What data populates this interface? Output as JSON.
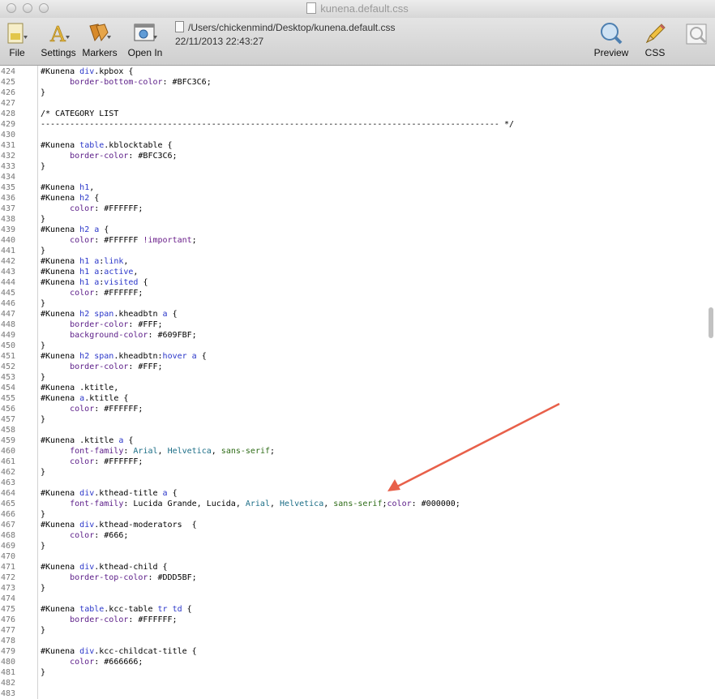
{
  "window": {
    "title": "kunena.default.css"
  },
  "toolbar": {
    "file_label": "File",
    "settings_label": "Settings",
    "markers_label": "Markers",
    "open_in_label": "Open In",
    "preview_label": "Preview",
    "css_label": "CSS",
    "path": "/Users/chickenmind/Desktop/kunena.default.css",
    "timestamp": "22/11/2013 22:43:27"
  },
  "editor": {
    "lines": [
      {
        "num": "424",
        "tokens": [
          [
            "sel",
            "#Kunena "
          ],
          [
            "tag",
            "div"
          ],
          [
            "sel",
            ".kpbox {"
          ]
        ]
      },
      {
        "num": "425",
        "tokens": [
          [
            "p",
            "      "
          ],
          [
            "prop",
            "border-bottom-color"
          ],
          [
            "p",
            ": #BFC3C6;"
          ]
        ]
      },
      {
        "num": "426",
        "tokens": [
          [
            "p",
            "}"
          ]
        ]
      },
      {
        "num": "427",
        "tokens": []
      },
      {
        "num": "428",
        "tokens": [
          [
            "cm",
            "/* CATEGORY LIST"
          ]
        ]
      },
      {
        "num": "429",
        "tokens": [
          [
            "cm",
            "---------------------------------------------------------------------------------------------- */"
          ]
        ]
      },
      {
        "num": "430",
        "tokens": []
      },
      {
        "num": "431",
        "tokens": [
          [
            "sel",
            "#Kunena "
          ],
          [
            "tag",
            "table"
          ],
          [
            "sel",
            ".kblocktable {"
          ]
        ]
      },
      {
        "num": "432",
        "tokens": [
          [
            "p",
            "      "
          ],
          [
            "prop",
            "border-color"
          ],
          [
            "p",
            ": #BFC3C6;"
          ]
        ]
      },
      {
        "num": "433",
        "tokens": [
          [
            "p",
            "}"
          ]
        ]
      },
      {
        "num": "434",
        "tokens": []
      },
      {
        "num": "435",
        "tokens": [
          [
            "sel",
            "#Kunena "
          ],
          [
            "tag",
            "h1"
          ],
          [
            "sel",
            ","
          ]
        ]
      },
      {
        "num": "436",
        "tokens": [
          [
            "sel",
            "#Kunena "
          ],
          [
            "tag",
            "h2"
          ],
          [
            "sel",
            " {"
          ]
        ]
      },
      {
        "num": "437",
        "tokens": [
          [
            "p",
            "      "
          ],
          [
            "prop",
            "color"
          ],
          [
            "p",
            ": #FFFFFF;"
          ]
        ]
      },
      {
        "num": "438",
        "tokens": [
          [
            "p",
            "}"
          ]
        ]
      },
      {
        "num": "439",
        "tokens": [
          [
            "sel",
            "#Kunena "
          ],
          [
            "tag",
            "h2 a"
          ],
          [
            "sel",
            " {"
          ]
        ]
      },
      {
        "num": "440",
        "tokens": [
          [
            "p",
            "      "
          ],
          [
            "prop",
            "color"
          ],
          [
            "p",
            ": #FFFFFF "
          ],
          [
            "imp",
            "!important"
          ],
          [
            "p",
            ";"
          ]
        ]
      },
      {
        "num": "441",
        "tokens": [
          [
            "p",
            "}"
          ]
        ]
      },
      {
        "num": "442",
        "tokens": [
          [
            "sel",
            "#Kunena "
          ],
          [
            "tag",
            "h1 a"
          ],
          [
            "sel",
            ":"
          ],
          [
            "tag",
            "link"
          ],
          [
            "sel",
            ","
          ]
        ]
      },
      {
        "num": "443",
        "tokens": [
          [
            "sel",
            "#Kunena "
          ],
          [
            "tag",
            "h1 a"
          ],
          [
            "sel",
            ":"
          ],
          [
            "tag",
            "active"
          ],
          [
            "sel",
            ","
          ]
        ]
      },
      {
        "num": "444",
        "tokens": [
          [
            "sel",
            "#Kunena "
          ],
          [
            "tag",
            "h1 a"
          ],
          [
            "sel",
            ":"
          ],
          [
            "tag",
            "visited"
          ],
          [
            "sel",
            " {"
          ]
        ]
      },
      {
        "num": "445",
        "tokens": [
          [
            "p",
            "      "
          ],
          [
            "prop",
            "color"
          ],
          [
            "p",
            ": #FFFFFF;"
          ]
        ]
      },
      {
        "num": "446",
        "tokens": [
          [
            "p",
            "}"
          ]
        ]
      },
      {
        "num": "447",
        "tokens": [
          [
            "sel",
            "#Kunena "
          ],
          [
            "tag",
            "h2 span"
          ],
          [
            "sel",
            ".kheadbtn "
          ],
          [
            "tag",
            "a"
          ],
          [
            "sel",
            " {"
          ]
        ]
      },
      {
        "num": "448",
        "tokens": [
          [
            "p",
            "      "
          ],
          [
            "prop",
            "border-color"
          ],
          [
            "p",
            ": #FFF;"
          ]
        ]
      },
      {
        "num": "449",
        "tokens": [
          [
            "p",
            "      "
          ],
          [
            "prop",
            "background-color"
          ],
          [
            "p",
            ": #609FBF;"
          ]
        ]
      },
      {
        "num": "450",
        "tokens": [
          [
            "p",
            "}"
          ]
        ]
      },
      {
        "num": "451",
        "tokens": [
          [
            "sel",
            "#Kunena "
          ],
          [
            "tag",
            "h2 span"
          ],
          [
            "sel",
            ".kheadbtn:"
          ],
          [
            "tag",
            "hover a"
          ],
          [
            "sel",
            " {"
          ]
        ]
      },
      {
        "num": "452",
        "tokens": [
          [
            "p",
            "      "
          ],
          [
            "prop",
            "border-color"
          ],
          [
            "p",
            ": #FFF;"
          ]
        ]
      },
      {
        "num": "453",
        "tokens": [
          [
            "p",
            "}"
          ]
        ]
      },
      {
        "num": "454",
        "tokens": [
          [
            "sel",
            "#Kunena .ktitle,"
          ]
        ]
      },
      {
        "num": "455",
        "tokens": [
          [
            "sel",
            "#Kunena "
          ],
          [
            "tag",
            "a"
          ],
          [
            "sel",
            ".ktitle {"
          ]
        ]
      },
      {
        "num": "456",
        "tokens": [
          [
            "p",
            "      "
          ],
          [
            "prop",
            "color"
          ],
          [
            "p",
            ": #FFFFFF;"
          ]
        ]
      },
      {
        "num": "457",
        "tokens": [
          [
            "p",
            "}"
          ]
        ]
      },
      {
        "num": "458",
        "tokens": []
      },
      {
        "num": "459",
        "tokens": [
          [
            "sel",
            "#Kunena .ktitle "
          ],
          [
            "tag",
            "a"
          ],
          [
            "sel",
            " {"
          ]
        ]
      },
      {
        "num": "460",
        "tokens": [
          [
            "p",
            "      "
          ],
          [
            "prop",
            "font-family"
          ],
          [
            "p",
            ": "
          ],
          [
            "font",
            "Arial"
          ],
          [
            "p",
            ", "
          ],
          [
            "font",
            "Helvetica"
          ],
          [
            "p",
            ", "
          ],
          [
            "gen",
            "sans-serif"
          ],
          [
            "p",
            ";"
          ]
        ]
      },
      {
        "num": "461",
        "tokens": [
          [
            "p",
            "      "
          ],
          [
            "prop",
            "color"
          ],
          [
            "p",
            ": #FFFFFF;"
          ]
        ]
      },
      {
        "num": "462",
        "tokens": [
          [
            "p",
            "}"
          ]
        ]
      },
      {
        "num": "463",
        "tokens": []
      },
      {
        "num": "464",
        "tokens": [
          [
            "sel",
            "#Kunena "
          ],
          [
            "tag",
            "div"
          ],
          [
            "sel",
            ".kthead-title "
          ],
          [
            "tag",
            "a"
          ],
          [
            "sel",
            " {"
          ]
        ]
      },
      {
        "num": "465",
        "tokens": [
          [
            "p",
            "      "
          ],
          [
            "prop",
            "font-family"
          ],
          [
            "p",
            ": Lucida Grande, Lucida, "
          ],
          [
            "font",
            "Arial"
          ],
          [
            "p",
            ", "
          ],
          [
            "font",
            "Helvetica"
          ],
          [
            "p",
            ", "
          ],
          [
            "gen",
            "sans-serif"
          ],
          [
            "p",
            ";"
          ],
          [
            "prop",
            "color"
          ],
          [
            "p",
            ": #000000;"
          ]
        ]
      },
      {
        "num": "466",
        "tokens": [
          [
            "p",
            "}"
          ]
        ]
      },
      {
        "num": "467",
        "tokens": [
          [
            "sel",
            "#Kunena "
          ],
          [
            "tag",
            "div"
          ],
          [
            "sel",
            ".kthead-moderators  {"
          ]
        ]
      },
      {
        "num": "468",
        "tokens": [
          [
            "p",
            "      "
          ],
          [
            "prop",
            "color"
          ],
          [
            "p",
            ": #666;"
          ]
        ]
      },
      {
        "num": "469",
        "tokens": [
          [
            "p",
            "}"
          ]
        ]
      },
      {
        "num": "470",
        "tokens": []
      },
      {
        "num": "471",
        "tokens": [
          [
            "sel",
            "#Kunena "
          ],
          [
            "tag",
            "div"
          ],
          [
            "sel",
            ".kthead-child {"
          ]
        ]
      },
      {
        "num": "472",
        "tokens": [
          [
            "p",
            "      "
          ],
          [
            "prop",
            "border-top-color"
          ],
          [
            "p",
            ": #DDD5BF;"
          ]
        ]
      },
      {
        "num": "473",
        "tokens": [
          [
            "p",
            "}"
          ]
        ]
      },
      {
        "num": "474",
        "tokens": []
      },
      {
        "num": "475",
        "tokens": [
          [
            "sel",
            "#Kunena "
          ],
          [
            "tag",
            "table"
          ],
          [
            "sel",
            ".kcc-table "
          ],
          [
            "tag",
            "tr td"
          ],
          [
            "sel",
            " {"
          ]
        ]
      },
      {
        "num": "476",
        "tokens": [
          [
            "p",
            "      "
          ],
          [
            "prop",
            "border-color"
          ],
          [
            "p",
            ": #FFFFFF;"
          ]
        ]
      },
      {
        "num": "477",
        "tokens": [
          [
            "p",
            "}"
          ]
        ]
      },
      {
        "num": "478",
        "tokens": []
      },
      {
        "num": "479",
        "tokens": [
          [
            "sel",
            "#Kunena "
          ],
          [
            "tag",
            "div"
          ],
          [
            "sel",
            ".kcc-childcat-title {"
          ]
        ]
      },
      {
        "num": "480",
        "tokens": [
          [
            "p",
            "      "
          ],
          [
            "prop",
            "color"
          ],
          [
            "p",
            ": #666666;"
          ]
        ]
      },
      {
        "num": "481",
        "tokens": [
          [
            "p",
            "}"
          ]
        ]
      },
      {
        "num": "482",
        "tokens": []
      },
      {
        "num": "483",
        "tokens": []
      }
    ]
  },
  "annotation": {
    "color": "#e8604a"
  }
}
